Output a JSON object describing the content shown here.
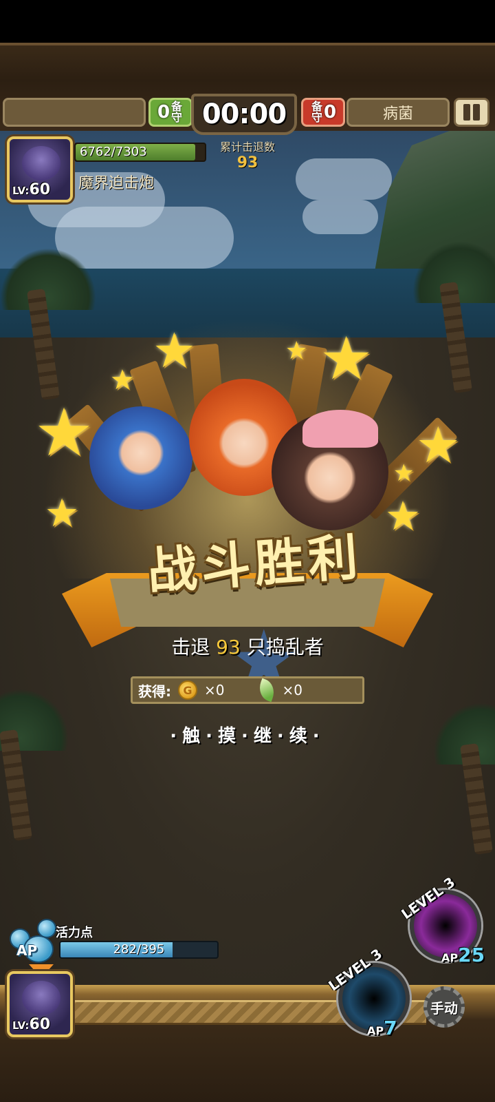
{
  "topbar": {
    "left_counter": "0",
    "left_counter_label": "备守",
    "timer": "00:00",
    "right_counter": "0",
    "right_counter_label": "备守",
    "stage_name": "病菌",
    "kills_label": "累计击退数",
    "kills_value": "93"
  },
  "unit_top": {
    "level_prefix": "LV:",
    "level": "60",
    "hp_text": "6762/7303",
    "hp_fraction": 0.926,
    "name": "魔界迫击炮",
    "icon": "demon-portrait-icon"
  },
  "result": {
    "title": "战斗胜利",
    "line_prefix": "击退",
    "line_count": "93",
    "line_suffix": "只捣乱者",
    "reward_label": "获得:",
    "coin_letter": "G",
    "coin_amount": "×0",
    "leaf_amount": "×0",
    "continue_text": "·触·摸·继·续·"
  },
  "ap": {
    "label": "活力点",
    "tag": "AP",
    "value_text": "282/395",
    "fraction": 0.714
  },
  "unit_bottom": {
    "level_prefix": "LV:",
    "level": "60",
    "icon": "demon-portrait-icon"
  },
  "skills": [
    {
      "level": "LEVEL 3",
      "ap_prefix": "AP",
      "ap": "25",
      "color": "#8a2a9a",
      "icon": "dark-vortex-icon"
    },
    {
      "level": "LEVEL 3",
      "ap_prefix": "AP",
      "ap": "7",
      "color": "#1e4a6a",
      "icon": "black-hole-icon"
    }
  ],
  "manual_button": "手动",
  "colors": {
    "gold": "#f7c83a",
    "hp_green": "#6aa838",
    "enemy_red": "#c83a2a"
  }
}
